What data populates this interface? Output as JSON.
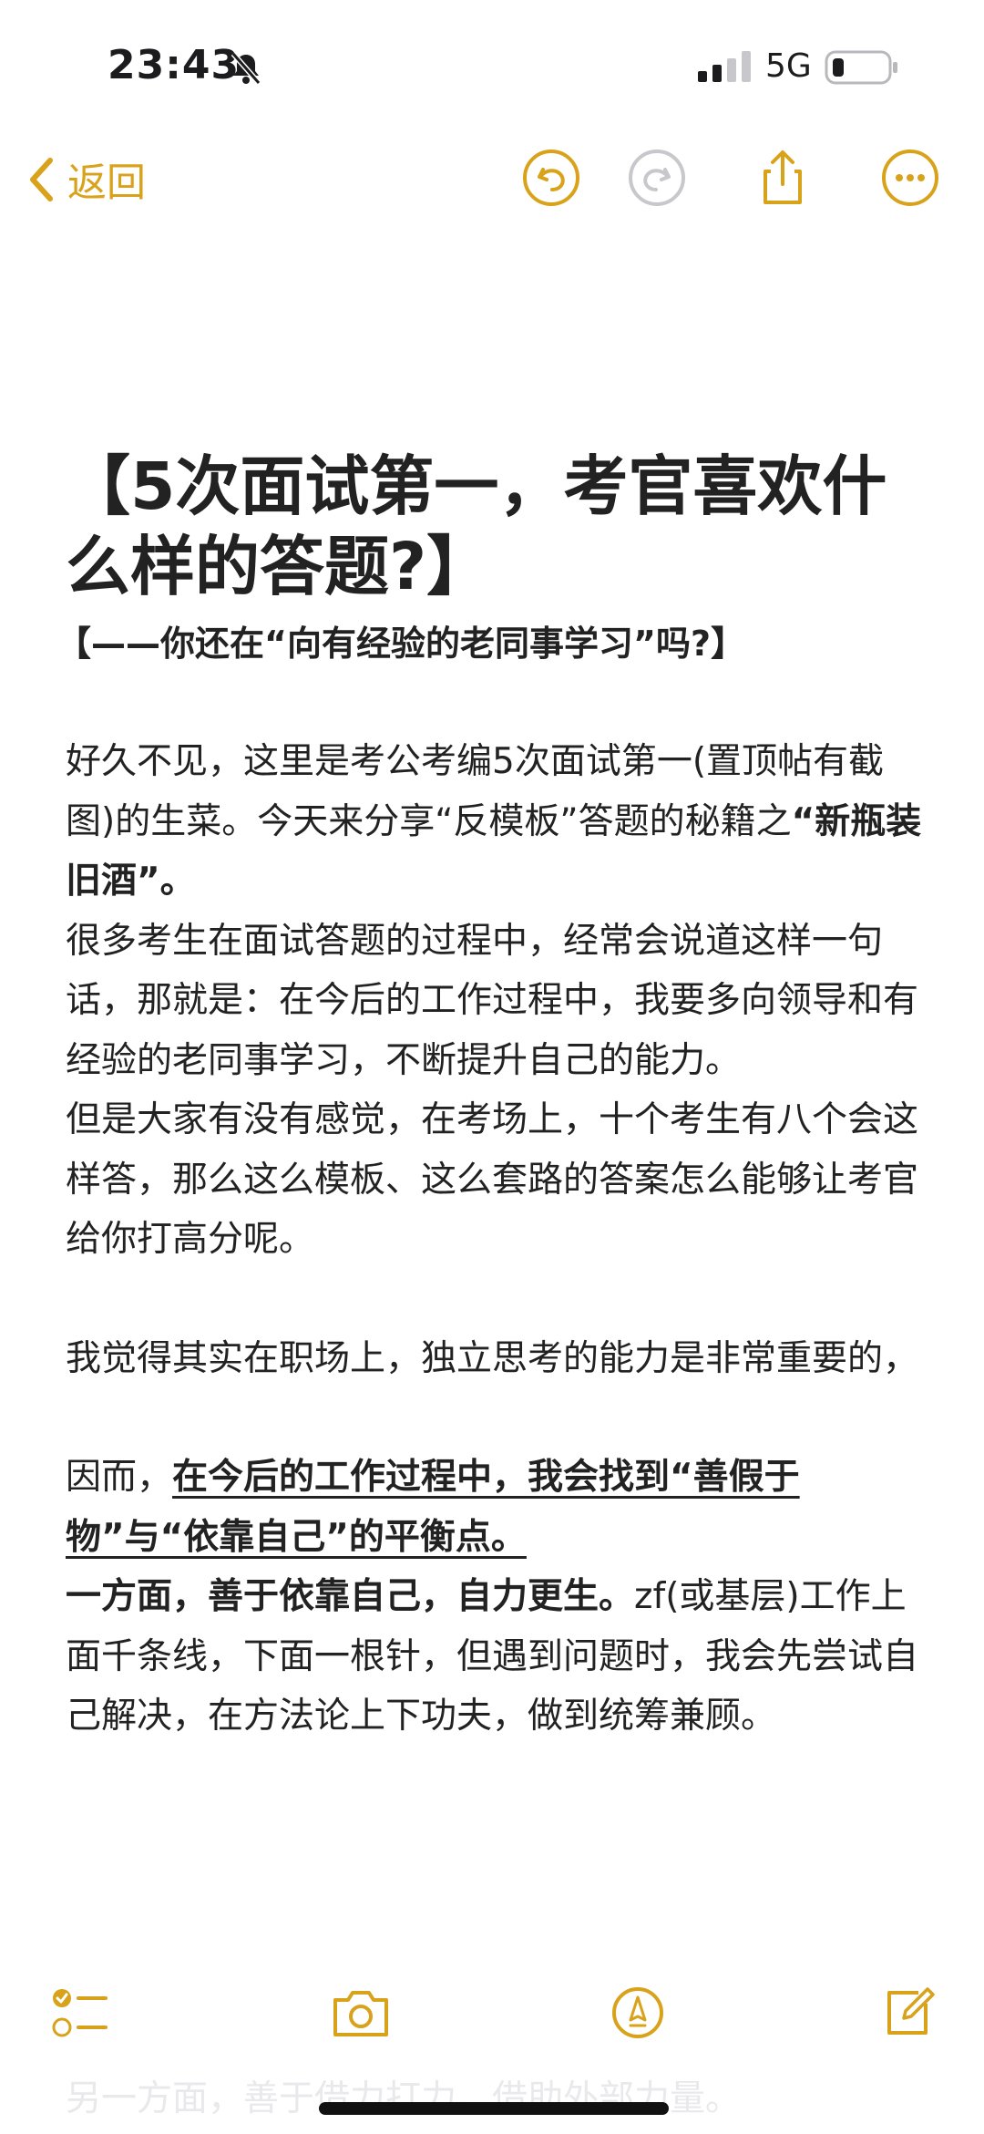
{
  "status_bar": {
    "time": "23:43",
    "network": "5G",
    "icons": [
      "bell-slash-icon",
      "signal-icon",
      "battery-icon"
    ]
  },
  "nav": {
    "back_label": "返回",
    "accent_color": "#d9a21b",
    "icons": [
      "chevron-left-icon",
      "undo-icon",
      "redo-icon",
      "share-icon",
      "more-icon"
    ]
  },
  "note": {
    "title": "【5次面试第一，考官喜欢什么样的答题?】",
    "subtitle": "【——你还在“向有经验的老同事学习”吗?】",
    "p1_text": "好久不见，这里是考公考编5次面试第一(置顶帖有截图)的生菜。今天来分享“反模板”答题的秘籍之",
    "p1_bold": "“新瓶装旧酒”。",
    "p2": "很多考生在面试答题的过程中，经常会说道这样一句话，那就是：在今后的工作过程中，我要多向领导和有经验的老同事学习，不断提升自己的能力。",
    "p3": "但是大家有没有感觉，在考场上，十个考生有八个会这样答，那么这么模板、这么套路的答案怎么能够让考官给你打高分呢。",
    "p4": "我觉得其实在职场上，独立思考的能力是非常重要的，",
    "p5_prefix": "因而，",
    "p5_underlined": "在今后的工作过程中，我会找到“善假于物”与“依靠自己”的平衡点。",
    "p6_bold": "一方面，善于依靠自己，自力更生。",
    "p6_text": "zf(或基层)工作上面千条线，下面一根针，但遇到问题时，我会先尝试自己解决，在方法论上下功夫，做到统筹兼顾。",
    "faded_line": "另一方面，善于借力打力，借助外部力量。"
  },
  "toolbar": {
    "icons": [
      "checklist-icon",
      "camera-icon",
      "markup-icon",
      "compose-icon"
    ]
  }
}
